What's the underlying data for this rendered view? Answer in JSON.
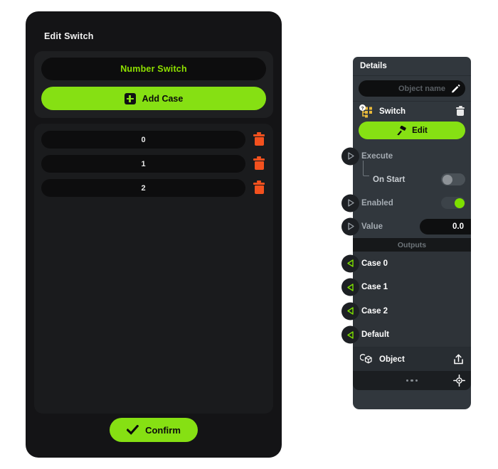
{
  "colors": {
    "accent_green": "#86e013",
    "trash_orange": "#f4511e",
    "panel_blue_gray": "#31373d",
    "dialog_dark": "#141416",
    "port_green": "#7ee000"
  },
  "dialog": {
    "title": "Edit Switch",
    "name_field": {
      "value": "Number Switch",
      "name": "switch-name-field"
    },
    "add_case": {
      "label": "Add Case",
      "icon": "plus-icon"
    },
    "cases": [
      {
        "value": "0",
        "delete_icon": "trash-icon"
      },
      {
        "value": "1",
        "delete_icon": "trash-icon"
      },
      {
        "value": "2",
        "delete_icon": "trash-icon"
      }
    ],
    "confirm": {
      "label": "Confirm",
      "icon": "check-icon"
    }
  },
  "details": {
    "header": "Details",
    "object_name": {
      "placeholder": "Object name",
      "value": "",
      "edit_icon": "pencil-icon"
    },
    "component": {
      "name": "Switch",
      "icon": "switch-component-icon",
      "help_badge": "question-mark-icon",
      "delete_icon": "trash-icon",
      "edit_button": {
        "label": "Edit",
        "icon": "paint-roller-icon"
      }
    },
    "inputs": [
      {
        "label": "Execute",
        "port": "execute-input-port",
        "control": "none"
      },
      {
        "label": "On Start",
        "control": "toggle",
        "state": "off",
        "child": true
      },
      {
        "label": "Enabled",
        "port": "enabled-input-port",
        "control": "toggle",
        "state": "on"
      },
      {
        "label": "Value",
        "port": "value-input-port",
        "control": "number",
        "value": "0.0"
      }
    ],
    "outputs_header": "Outputs",
    "outputs": [
      {
        "label": "Case 0",
        "port": "case-0-output-port"
      },
      {
        "label": "Case 1",
        "port": "case-1-output-port"
      },
      {
        "label": "Case 2",
        "port": "case-2-output-port"
      },
      {
        "label": "Default",
        "port": "default-output-port"
      }
    ],
    "object_row": {
      "label": "Object",
      "icon": "cube-icon",
      "action_icon": "load-object-icon"
    },
    "footer": {
      "more_label": "•••",
      "target_icon": "crosshair-icon"
    }
  }
}
